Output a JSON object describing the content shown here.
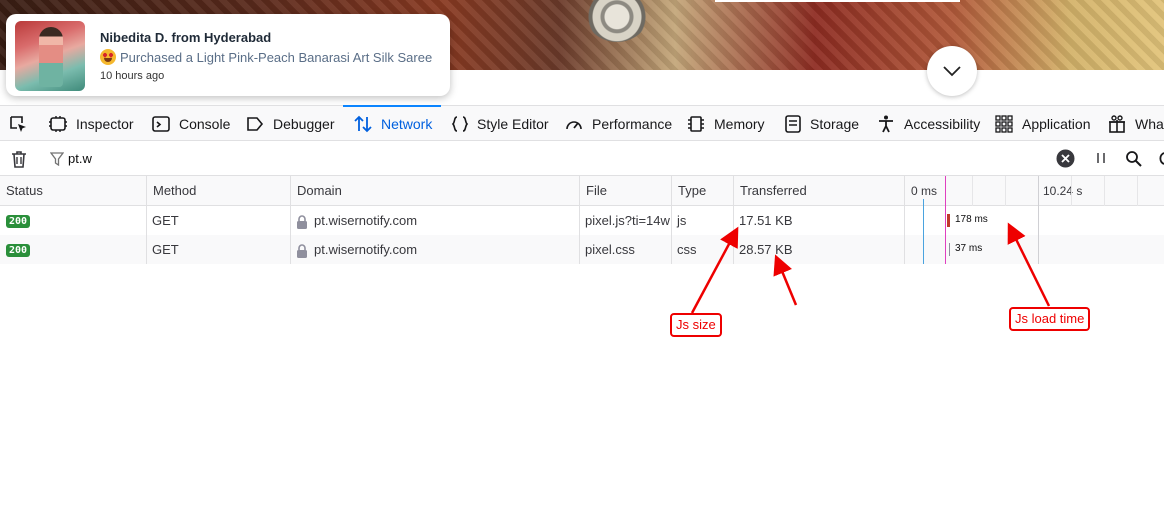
{
  "notification": {
    "name": "Nibedita D. from Hyderabad",
    "description": "Purchased a Light Pink-Peach Banarasi Art Silk Saree",
    "time": "10 hours ago"
  },
  "devtools": {
    "tabs": [
      {
        "label": "Inspector",
        "icon": "inspector-icon"
      },
      {
        "label": "Console",
        "icon": "console-icon"
      },
      {
        "label": "Debugger",
        "icon": "debugger-icon"
      },
      {
        "label": "Network",
        "icon": "network-icon",
        "active": true
      },
      {
        "label": "Style Editor",
        "icon": "style-editor-icon"
      },
      {
        "label": "Performance",
        "icon": "performance-icon"
      },
      {
        "label": "Memory",
        "icon": "memory-icon"
      },
      {
        "label": "Storage",
        "icon": "storage-icon"
      },
      {
        "label": "Accessibility",
        "icon": "accessibility-icon"
      },
      {
        "label": "Application",
        "icon": "application-icon"
      },
      {
        "label": "What",
        "icon": "whats-new-icon"
      }
    ],
    "filter": {
      "value": "pt.w"
    },
    "columns": [
      "Status",
      "Method",
      "Domain",
      "File",
      "Type",
      "Transferred"
    ],
    "waterfall": {
      "start_label": "0 ms",
      "end_label": "10.24 s"
    },
    "rows": [
      {
        "status": "200",
        "method": "GET",
        "domain": "pt.wisernotify.com",
        "file": "pixel.js?ti=14w",
        "type": "js",
        "transferred": "17.51 KB",
        "timing": "178 ms"
      },
      {
        "status": "200",
        "method": "GET",
        "domain": "pt.wisernotify.com",
        "file": "pixel.css",
        "type": "css",
        "transferred": "28.57 KB",
        "timing": "37 ms"
      }
    ]
  },
  "annotations": {
    "js_size": "Js size",
    "js_load_time": "Js load time"
  },
  "colors": {
    "accent": "#0060df",
    "status_ok": "#2a8f3a",
    "annotation": "#e00000"
  }
}
